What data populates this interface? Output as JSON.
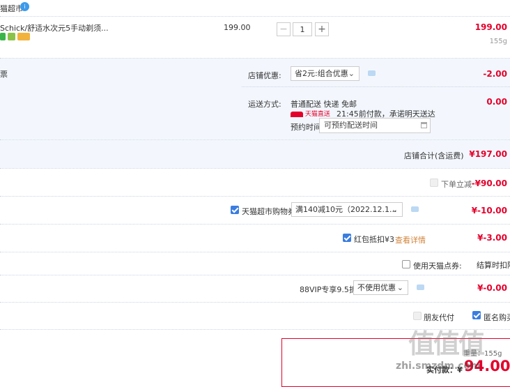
{
  "store": {
    "name": "猫超市",
    "badge": "i"
  },
  "item": {
    "title": "Schick/舒适水次元5手动剃须...",
    "unit_price": "199.00",
    "quantity": "1",
    "total": "199.00",
    "weight": "155g",
    "minus": "−",
    "plus": "+"
  },
  "invoice_label": "票",
  "shop_discount": {
    "label": "店铺优惠:",
    "option": "省2元:组合优惠",
    "amount": "-2.00"
  },
  "delivery": {
    "label": "运送方式:",
    "method": "普通配送 快递 免邮",
    "brand": "天猫直送",
    "promise": "21:45前付款，承诺明天送达",
    "schedule_label": "预约时间",
    "schedule_placeholder": "可预约配送时间",
    "amount": "0.00"
  },
  "store_total": {
    "label": "店铺合计(含运费)",
    "amount": "¥197.00"
  },
  "instant_discount": {
    "label": "下单立减",
    "amount": "-¥90.00"
  },
  "coupon": {
    "label": "天猫超市购物券",
    "option": "满140减10元（2022.12.1...",
    "amount": "¥-10.00"
  },
  "red_packet": {
    "label": "红包抵扣¥3",
    "link": "查看详情",
    "amount": "¥-3.00"
  },
  "points": {
    "label": "使用天猫点券:",
    "note": "结算时扣除"
  },
  "vip": {
    "label": "88VIP专享9.5折",
    "option": "不使用优惠",
    "amount": "¥-0.00"
  },
  "options": {
    "friend_pay": "朋友代付",
    "anonymous": "匿名购买"
  },
  "summary": {
    "weight": "重量：155g",
    "paid_label": "实付款：¥",
    "paid": "94.00"
  },
  "watermark": {
    "text": "值值值",
    "site": "zhi.smzdm.com"
  },
  "colors": {
    "accent": "#e4002b",
    "band": "#f3f7fd",
    "checkbox": "#3a7de0"
  }
}
